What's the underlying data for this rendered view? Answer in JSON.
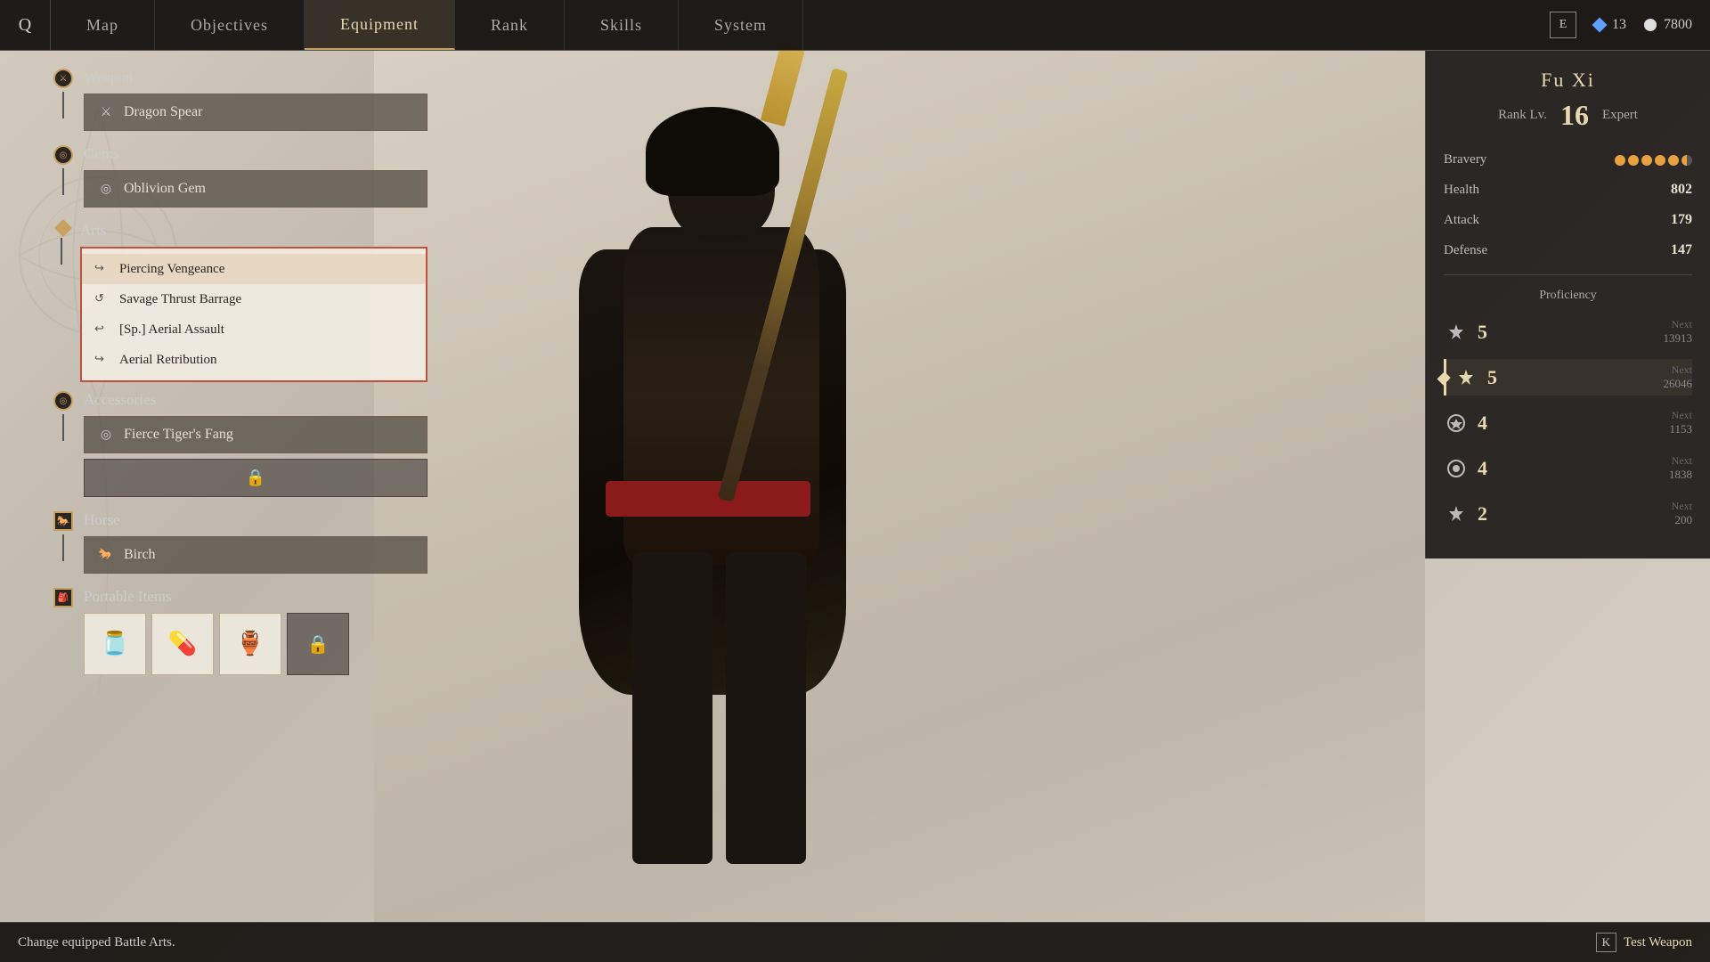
{
  "nav": {
    "logo": "Q",
    "tabs": [
      {
        "label": "Map",
        "active": false
      },
      {
        "label": "Objectives",
        "active": false
      },
      {
        "label": "Equipment",
        "active": true
      },
      {
        "label": "Rank",
        "active": false
      },
      {
        "label": "Skills",
        "active": false
      },
      {
        "label": "System",
        "active": false
      }
    ],
    "e_key": "E",
    "currency_diamond": "◆",
    "currency_diamond_value": "13",
    "currency_circle_value": "7800"
  },
  "character": {
    "name": "Fu Xi",
    "rank_label": "Rank Lv.",
    "rank_level": "16",
    "rank_tier": "Expert",
    "stats": {
      "bravery_label": "Bravery",
      "bravery_dots": 5,
      "bravery_half": true,
      "health_label": "Health",
      "health_value": "802",
      "attack_label": "Attack",
      "attack_value": "179",
      "defense_label": "Defense",
      "defense_value": "147"
    },
    "proficiency": {
      "label": "Proficiency",
      "rows": [
        {
          "icon": "🗡",
          "level": "5",
          "next_label": "Next",
          "next_value": "13913",
          "active": false
        },
        {
          "icon": "🗡",
          "level": "5",
          "next_label": "Next",
          "next_value": "26046",
          "active": true
        },
        {
          "icon": "🛡",
          "level": "4",
          "next_label": "Next",
          "next_value": "1153",
          "active": false
        },
        {
          "icon": "⊙",
          "level": "4",
          "next_label": "Next",
          "next_value": "1838",
          "active": false
        },
        {
          "icon": "🗡",
          "level": "2",
          "next_label": "Next",
          "next_value": "200",
          "active": false
        }
      ]
    }
  },
  "equipment": {
    "weapon": {
      "label": "Weapon",
      "name": "Dragon Spear",
      "icon": "⚔"
    },
    "gems": {
      "label": "Gems",
      "name": "Oblivion Gem",
      "icon": "◎"
    },
    "arts": {
      "label": "Arts",
      "items": [
        {
          "name": "Piercing Vengeance",
          "icon": "↪",
          "selected": true
        },
        {
          "name": "Savage Thrust Barrage",
          "icon": "↺",
          "selected": false
        },
        {
          "name": "[Sp.] Aerial Assault",
          "icon": "↩",
          "selected": false
        },
        {
          "name": "Aerial Retribution",
          "icon": "↪",
          "selected": false
        }
      ]
    },
    "accessories": {
      "label": "Accessories",
      "slot1": "Fierce Tiger's Fang",
      "slot1_icon": "◎",
      "slot2_locked": true
    },
    "horse": {
      "label": "Horse",
      "name": "Birch",
      "icon": "🐎"
    },
    "portable_items": {
      "label": "Portable Items",
      "items": [
        {
          "icon": "🫙",
          "count": "",
          "locked": false
        },
        {
          "icon": "💊",
          "count": "",
          "locked": false
        },
        {
          "icon": "🪖",
          "count": "",
          "locked": false
        },
        {
          "icon": "🔒",
          "count": "",
          "locked": true
        }
      ]
    }
  },
  "bottom_bar": {
    "status_text": "Change equipped Battle Arts.",
    "test_weapon_key": "K",
    "test_weapon_label": "Test Weapon"
  }
}
